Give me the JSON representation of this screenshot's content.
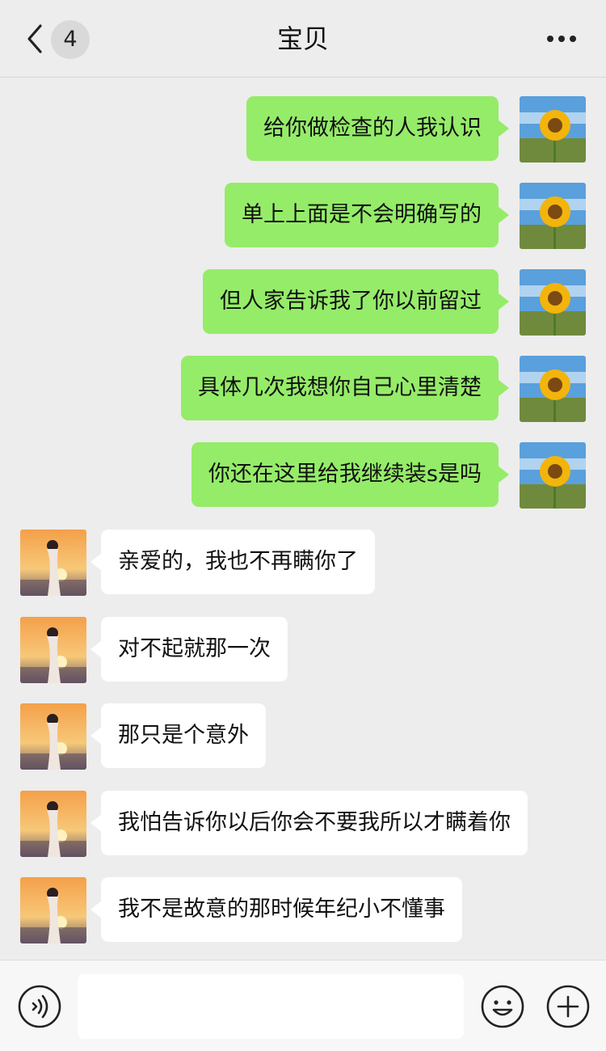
{
  "header": {
    "unread_count": "4",
    "title": "宝贝"
  },
  "messages": [
    {
      "side": "out",
      "text": "给你做检查的人我认识"
    },
    {
      "side": "out",
      "text": "单上上面是不会明确写的"
    },
    {
      "side": "out",
      "text": "但人家告诉我了你以前留过"
    },
    {
      "side": "out",
      "text": "具体几次我想你自己心里清楚"
    },
    {
      "side": "out",
      "text": "你还在这里给我继续装s是吗"
    },
    {
      "side": "in",
      "text": "亲爱的，我也不再瞒你了"
    },
    {
      "side": "in",
      "text": "对不起就那一次"
    },
    {
      "side": "in",
      "text": "那只是个意外"
    },
    {
      "side": "in",
      "text": "我怕告诉你以后你会不要我所以才瞒着你"
    },
    {
      "side": "in",
      "text": "我不是故意的那时候年纪小不懂事"
    }
  ],
  "input": {
    "value": ""
  },
  "colors": {
    "outgoing_bubble": "#95ec69",
    "incoming_bubble": "#ffffff",
    "background": "#ededed"
  },
  "icons": {
    "back": "chevron-left-icon",
    "more": "more-dots-icon",
    "voice": "voice-icon",
    "emoji": "smiley-icon",
    "plus": "plus-icon"
  }
}
